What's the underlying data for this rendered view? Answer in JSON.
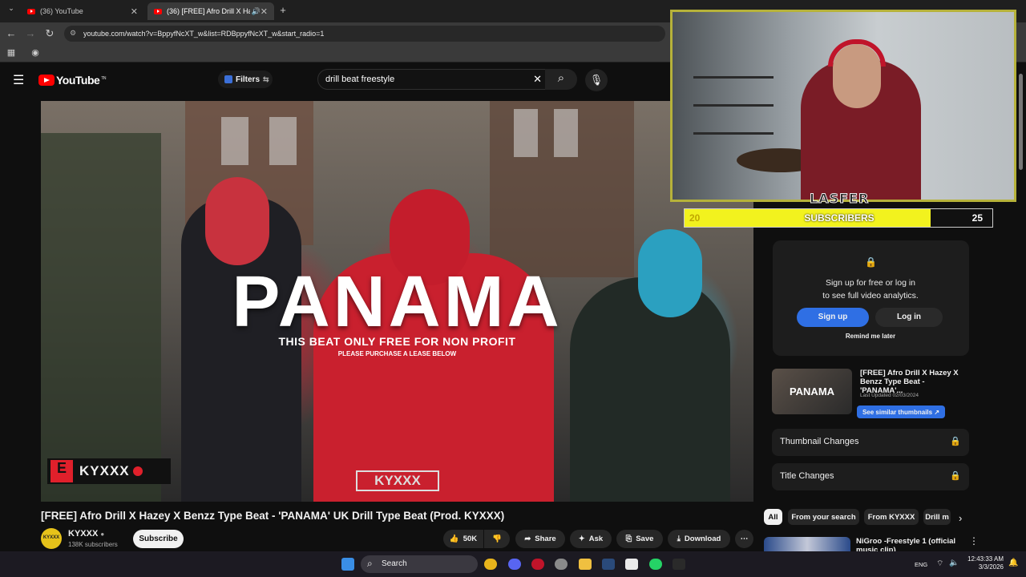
{
  "browser": {
    "tabs": [
      {
        "title": "(36) YouTube"
      },
      {
        "title": "(36) [FREE] Afro Drill X Haz…"
      }
    ],
    "url": "youtube.com/watch?v=BppyfNcXT_w&list=RDBppyfNcXT_w&start_radio=1"
  },
  "youtube": {
    "logo_text": "YouTube",
    "logo_sup": "TN",
    "filters_label": "Filters",
    "search_value": "drill beat freestyle"
  },
  "video": {
    "big_title": "PANAMA",
    "subtitle": "THIS BEAT ONLY FREE FOR NON PROFIT",
    "subtitle2": "PLEASE PURCHASE A LEASE BELOW",
    "watermark": "KYXXX",
    "watermark_center": "KYXXX",
    "title": "[FREE] Afro Drill X Hazey X Benzz Type Beat - 'PANAMA' UK Drill Type Beat (Prod. KYXXX)"
  },
  "channel": {
    "name": "KYXXX",
    "avatar_text": "KYXXX",
    "subscribers": "138K subscribers",
    "subscribe_label": "Subscribe"
  },
  "actions": {
    "likes": "50K",
    "share": "Share",
    "ask": "Ask",
    "save": "Save",
    "download": "Download"
  },
  "overlay": {
    "streamer_name": "LASFER",
    "sub_current": "20",
    "sub_label": "SUBSCRIBERS",
    "sub_goal": "25",
    "sub_progress": 0.8
  },
  "sidebar": {
    "analytics_text_1": "Sign up for free or log in",
    "analytics_text_2": "to see full video analytics.",
    "signup": "Sign up",
    "login": "Log in",
    "remind": "Remind me later",
    "thumb_text": "PANAMA",
    "thumb_title": "[FREE] Afro Drill X Hazey X Benzz Type Beat - 'PANAMA'...",
    "thumb_date": "Last Updated 02/03/2024",
    "similar": "See similar thumbnails",
    "thumbnail_changes": "Thumbnail Changes",
    "title_changes": "Title Changes",
    "chips": [
      "All",
      "From your search",
      "From KYXXX",
      "Drill m"
    ],
    "rec_title": "NiGroo -Freestyle 1 (official music clip)"
  },
  "taskbar": {
    "search": "Search",
    "lang": "ENG",
    "time": "12:43:33 AM",
    "date": "3/3/2026"
  },
  "colors": {
    "accent_red": "#ff0000",
    "link_blue": "#2f6fe4",
    "overlay_yellow": "#f2f21e"
  }
}
